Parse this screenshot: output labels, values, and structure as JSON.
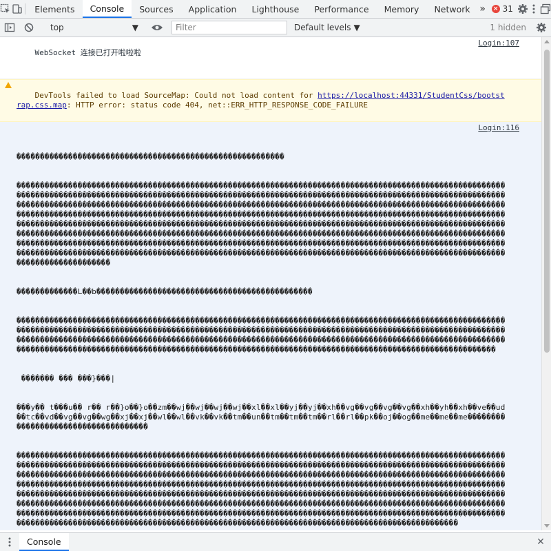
{
  "tabs": {
    "items": [
      "Elements",
      "Console",
      "Sources",
      "Application",
      "Lighthouse",
      "Performance",
      "Memory",
      "Network"
    ],
    "more": "»",
    "error_count": "31"
  },
  "toolbar": {
    "context": "top",
    "filter_placeholder": "Filter",
    "levels": "Default levels",
    "hidden": "1 hidden"
  },
  "messages": {
    "log1": {
      "text": "WebSocket 连接已打开啦啦啦",
      "source": "Login:107"
    },
    "warn": {
      "prefix": "DevTools failed to load SourceMap: Could not load content for ",
      "url": "https://localhost:44331/StudentCss/bootstrap.css.map",
      "suffix": ": HTTP error: status code 404, net::ERR_HTTP_RESPONSE_CODE_FAILURE"
    },
    "log2": {
      "source": "Login:116",
      "first_line": "���������������������������������������������������������",
      "block_top": "������������������������������������������������������������������������������������������������������������������������������������������������������������������������������������������������������������������������������������������������������������������������������������������������������������������������������������������������������������������������������������������������������������������������������������������������������������������������������������������������������������������������������������������������������������������������������������������������������������������������������������������������������������������������������������������������������������������������������������������������������������������������������������������������������������������������������������������������������������������������������������",
      "block_mid1": "�������������L��b����������������������������������������������",
      "block_mid2": "������������������������������������������������������������������������������������������������������������������������������������������������������������������������������������������������������������������������������������������������������������������������������������������������������������������������������������������������������������������������������������������������������������������������������",
      "line_a": " ������� ��� ���}���|",
      "line_b": "���y�� t���u�� r�� r��}o��}o��zm��wj��wj��wj��wj��xl��xl��yj��yj��xh��vg��vg��vg��vg��xh��yh��xh��ve��ud��tc��vd��vg��vg��wg��xj��xj��wl��wl��vk��vk��tm��un��tm��tm��tm��rl��rl��pk��oj��og��me��me��me������������������������������������",
      "block_bottom": "������������������������������������������������������������������������������������������������������������������������������������������������������������������������������������������������������������������������������������������������������������������������������������������������������������������������������������������������������������������������������������������������������������������������������������������������������������������������������������������������������������������������������������������������������������������������������������������������������������������������������������������������������������������������������������������������������������������������������������������������������������������������������������������������������������������������������������������������������"
    }
  },
  "drawer": {
    "tab": "Console"
  },
  "colors": {
    "accent": "#1a73e8",
    "error": "#e8453c",
    "warning_bg": "#fffbe5",
    "selected_bg": "#eef3fb"
  }
}
